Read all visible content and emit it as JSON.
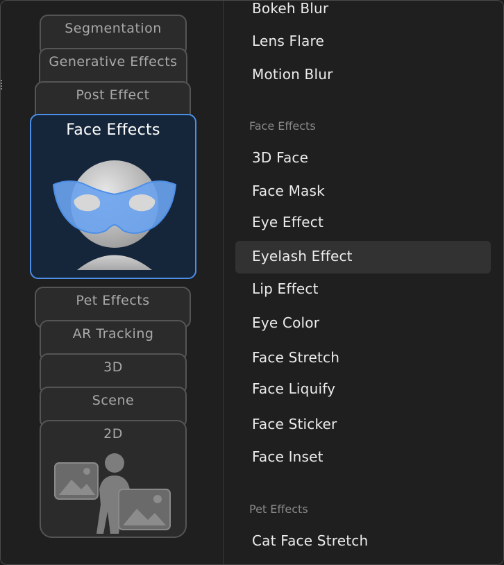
{
  "categories": [
    {
      "label": "Segmentation"
    },
    {
      "label": "Generative Effects"
    },
    {
      "label": "Post Effect"
    },
    {
      "label": "Face Effects"
    },
    {
      "label": "Pet Effects"
    },
    {
      "label": "AR Tracking"
    },
    {
      "label": "3D"
    },
    {
      "label": "Scene"
    },
    {
      "label": "2D"
    }
  ],
  "effects": {
    "post_items": [
      "Bokeh Blur",
      "Lens Flare",
      "Motion Blur"
    ],
    "face_header": "Face Effects",
    "face_items": [
      "3D Face",
      "Face Mask",
      "Eye Effect",
      "Eyelash Effect",
      "Lip Effect",
      "Eye Color",
      "Face Stretch",
      "Face Liquify",
      "Face Sticker",
      "Face Inset"
    ],
    "pet_header": "Pet Effects",
    "pet_items": [
      "Cat Face Stretch"
    ],
    "selected": "Eyelash Effect"
  },
  "colors": {
    "accent": "#4c8fe6",
    "mask": "#6aa3f0",
    "active_card_bg": "#16263a"
  },
  "icons": {
    "face_effects": "face-mask-icon",
    "two_d": "person-with-images-icon"
  }
}
